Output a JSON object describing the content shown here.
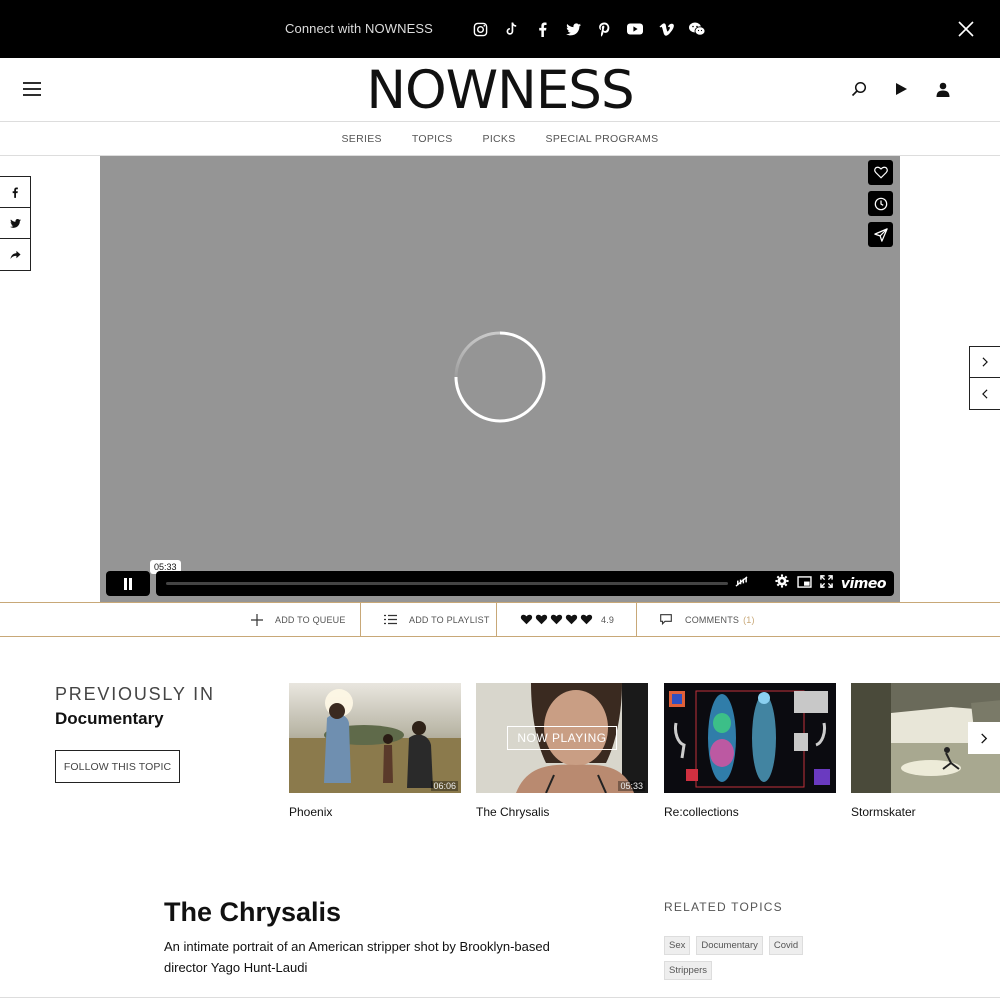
{
  "promo": {
    "connect_text": "Connect with NOWNESS",
    "social_icons": [
      "instagram-icon",
      "tiktok-icon",
      "facebook-icon",
      "twitter-icon",
      "pinterest-icon",
      "youtube-icon",
      "vimeo-icon",
      "wechat-icon"
    ]
  },
  "header": {
    "logo": "NOWNESS"
  },
  "nav": {
    "items": [
      "SERIES",
      "TOPICS",
      "PICKS",
      "SPECIAL PROGRAMS"
    ]
  },
  "player": {
    "time_tooltip": "05:33",
    "brand": "vimeo",
    "state": "loading"
  },
  "actions": {
    "add_to_queue": "ADD TO QUEUE",
    "add_to_playlist": "ADD TO PLAYLIST",
    "rating": "4.9",
    "comments_label": "COMMENTS",
    "comments_count": "(1)"
  },
  "previously": {
    "label": "PREVIOUSLY IN",
    "topic": "Documentary",
    "follow_label": "FOLLOW THIS TOPIC",
    "now_playing_label": "NOW PLAYING",
    "cards": [
      {
        "title": "Phoenix",
        "duration": "06:06"
      },
      {
        "title": "The Chrysalis",
        "duration": "05:33"
      },
      {
        "title": "Re:collections",
        "duration": ""
      },
      {
        "title": "Stormskater",
        "duration": ""
      }
    ]
  },
  "article": {
    "title": "The Chrysalis",
    "description": "An intimate portrait of an American stripper shot by Brooklyn-based director Yago Hunt-Laudi",
    "related_label": "RELATED TOPICS",
    "tags": [
      "Sex",
      "Documentary",
      "Covid",
      "Strippers"
    ]
  },
  "colors": {
    "accent": "#c8a878",
    "video_bg": "#959595"
  }
}
